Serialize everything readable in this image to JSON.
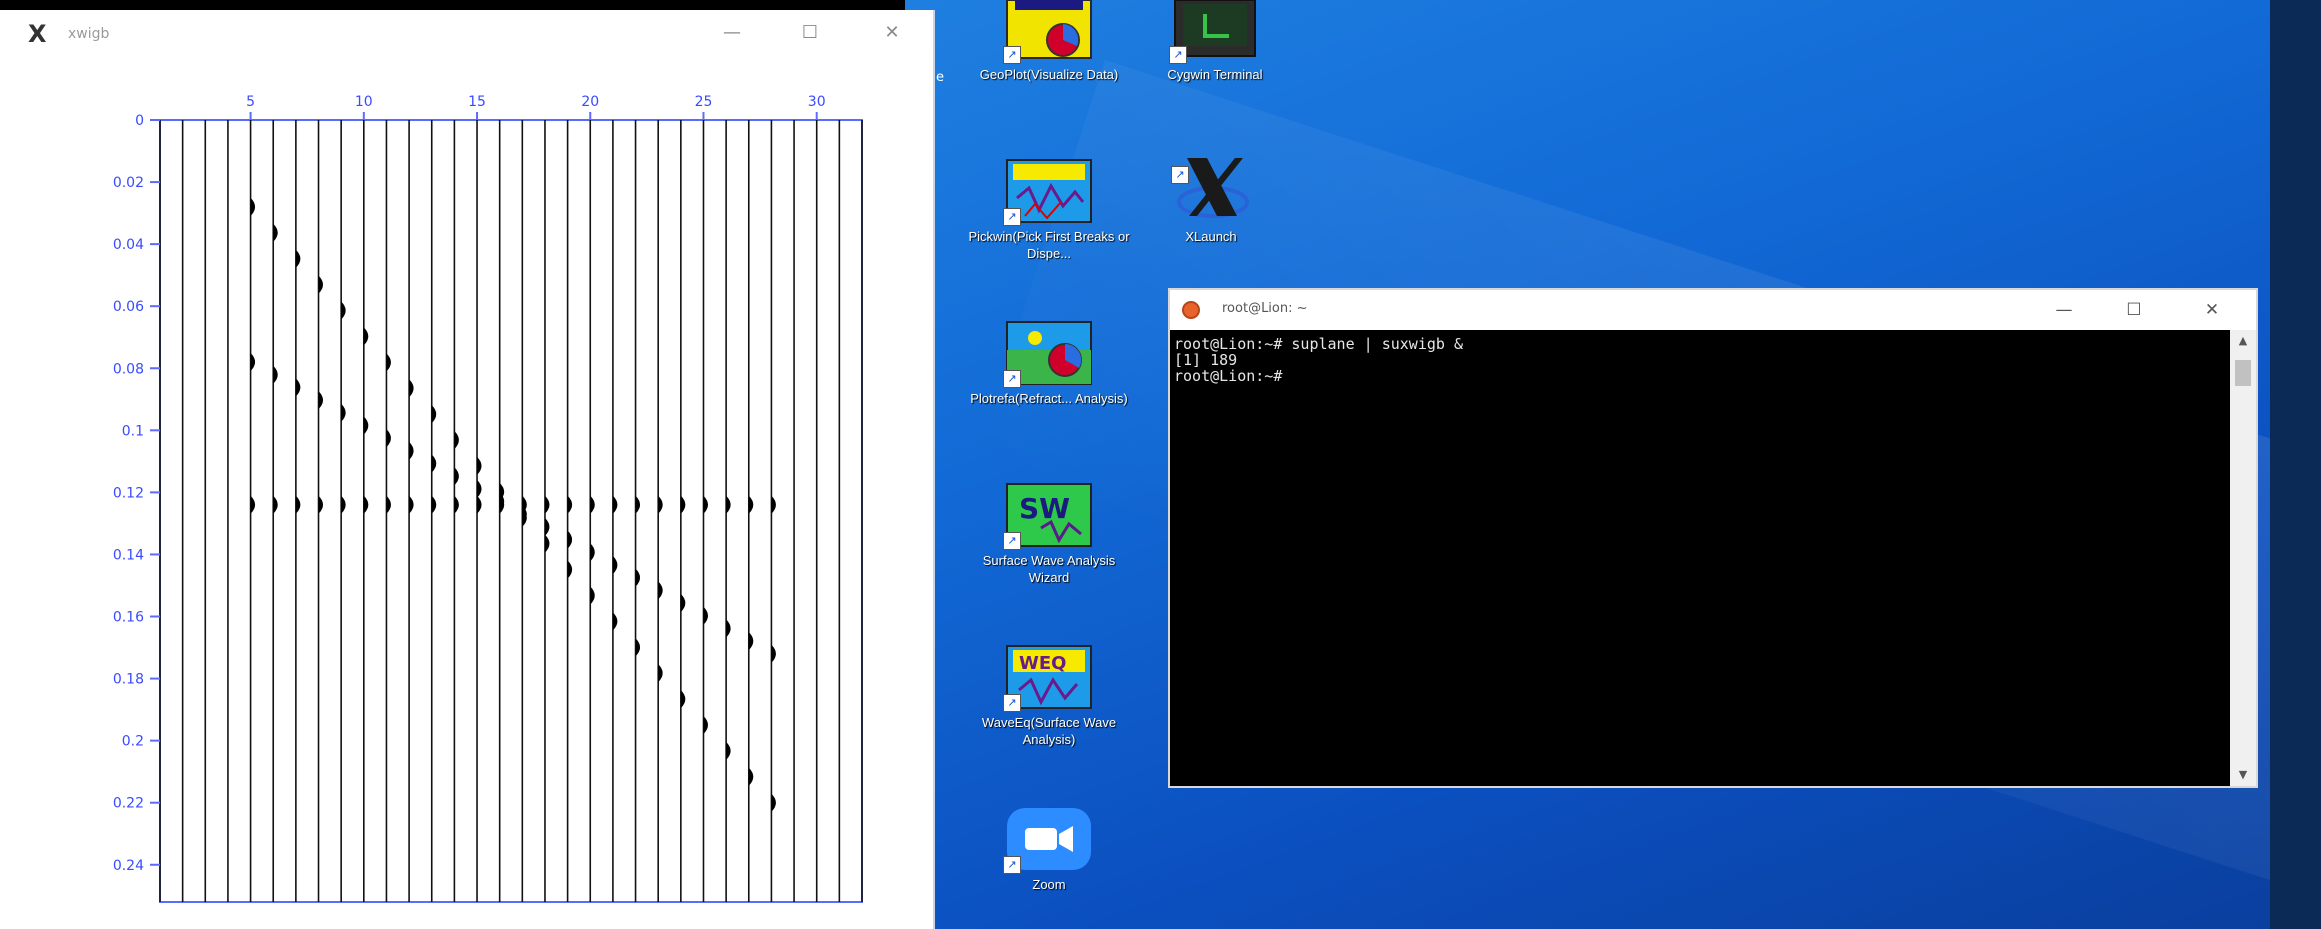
{
  "xwigb": {
    "title": "xwigb",
    "logo": "X",
    "controls": {
      "minimize": "—",
      "maximize": "☐",
      "close": "✕"
    }
  },
  "chart_data": {
    "type": "wiggle-trace seismic plot",
    "x_ticks": [
      "5",
      "10",
      "15",
      "20",
      "25",
      "30"
    ],
    "y_ticks": [
      "0",
      "0.02",
      "0.04",
      "0.06",
      "0.08",
      "0.1",
      "0.12",
      "0.14",
      "0.16",
      "0.18",
      "0.2",
      "0.22",
      "0.24"
    ],
    "xlim": [
      1,
      32
    ],
    "ylim": [
      0,
      0.252
    ],
    "trace_count": 32,
    "trace_x": [
      1,
      32
    ],
    "events": [
      {
        "trace_start": 5,
        "t_start": 0.028,
        "trace_end": 28,
        "t_end": 0.22
      },
      {
        "trace_start": 5,
        "t_start": 0.078,
        "trace_end": 28,
        "t_end": 0.172
      },
      {
        "trace_start": 5,
        "t_start": 0.124,
        "trace_end": 28,
        "t_end": 0.124
      }
    ]
  },
  "desktop": {
    "icons": [
      {
        "id": "geoplot",
        "label": "GeoPlot(Visualize Data)"
      },
      {
        "id": "cygwin",
        "label": "Cygwin Terminal"
      },
      {
        "id": "pickwin",
        "label": "Pickwin(Pick First Breaks or Dispe..."
      },
      {
        "id": "xlaunch",
        "label": "XLaunch"
      },
      {
        "id": "plotrefa",
        "label": "Plotrefa(Refract... Analysis)"
      },
      {
        "id": "surface-wave",
        "label": "Surface Wave Analysis Wizard"
      },
      {
        "id": "waveeq",
        "label": "WaveEq(Surface Wave Analysis)"
      },
      {
        "id": "zoom",
        "label": "Zoom"
      }
    ],
    "edge_char": "e",
    "colors": {
      "accent": "#1f7fe0",
      "terminal_bg": "#000000",
      "cygwin": "#e8632a"
    }
  },
  "terminal": {
    "title": "root@Lion: ~",
    "controls": {
      "minimize": "—",
      "maximize": "☐",
      "close": "✕"
    },
    "lines": [
      "root@Lion:~# suplane | suxwigb &",
      "[1] 189",
      "root@Lion:~#"
    ],
    "scroll_up": "▲",
    "scroll_down": "▼"
  }
}
